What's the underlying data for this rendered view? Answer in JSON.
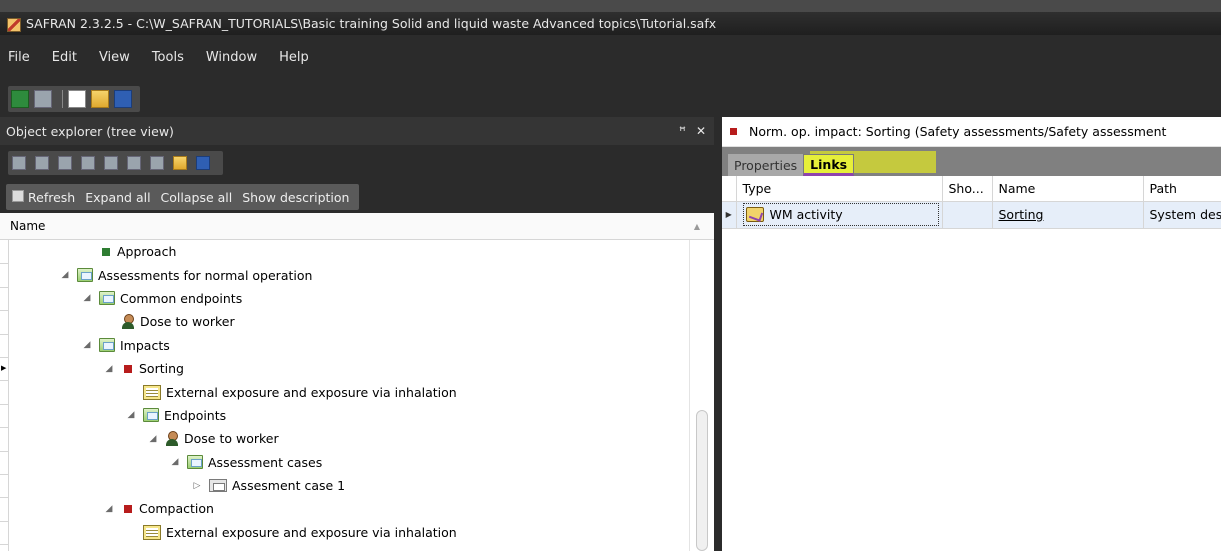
{
  "window": {
    "title": "SAFRAN 2.3.2.5 - C:\\W_SAFRAN_TUTORIALS\\Basic training Solid and liquid waste Advanced topics\\Tutorial.safx"
  },
  "menu": [
    "File",
    "Edit",
    "View",
    "Tools",
    "Window",
    "Help"
  ],
  "toolbar": {
    "icons": [
      "back-icon",
      "forward-icon",
      "new-file-icon",
      "open-folder-icon",
      "save-icon"
    ]
  },
  "object_explorer": {
    "title": "Object explorer (tree view)",
    "pin_glyph": "ꟸ",
    "close_glyph": "✕",
    "tools": [
      "copy-icon",
      "cut-icon",
      "paste-icon",
      "rename-icon",
      "delete-icon",
      "add-icon",
      "attach-icon",
      "properties-icon",
      "find-icon"
    ],
    "actions": {
      "refresh": "Refresh",
      "expand_all": "Expand all",
      "collapse_all": "Collapse all",
      "show_description": "Show description"
    },
    "column_header": "Name",
    "tree": [
      {
        "label": "Approach",
        "level": 4,
        "icon": "approach",
        "expander": "none"
      },
      {
        "label": "Assessments for normal operation",
        "level": 3,
        "icon": "folder",
        "expander": "expanded"
      },
      {
        "label": "Common endpoints",
        "level": 4,
        "icon": "folder",
        "expander": "expanded"
      },
      {
        "label": "Dose to worker",
        "level": 5,
        "icon": "person",
        "expander": "none"
      },
      {
        "label": "Impacts",
        "level": 4,
        "icon": "folder",
        "expander": "expanded"
      },
      {
        "label": "Sorting",
        "level": 5,
        "icon": "impact",
        "expander": "expanded"
      },
      {
        "label": "External exposure and exposure via inhalation",
        "level": 6,
        "icon": "sheet",
        "expander": "none"
      },
      {
        "label": "Endpoints",
        "level": 6,
        "icon": "folder",
        "expander": "expanded"
      },
      {
        "label": "Dose to worker",
        "level": 7,
        "icon": "person",
        "expander": "expanded"
      },
      {
        "label": "Assessment cases",
        "level": 8,
        "icon": "folder",
        "expander": "expanded"
      },
      {
        "label": "Assesment case 1",
        "level": 9,
        "icon": "case",
        "expander": "collapsed"
      },
      {
        "label": "Compaction",
        "level": 5,
        "icon": "impact",
        "expander": "expanded"
      },
      {
        "label": "External exposure and exposure via inhalation",
        "level": 6,
        "icon": "sheet",
        "expander": "none"
      }
    ]
  },
  "detail_panel": {
    "header": "Norm. op. impact: Sorting  (Safety assessments/Safety assessment",
    "tabs": {
      "properties": "Properties",
      "links": "Links"
    },
    "links_table": {
      "columns": [
        "Type",
        "Sho...",
        "Name",
        "Path"
      ],
      "rows": [
        {
          "type": "WM activity",
          "sho": "",
          "name": "Sorting",
          "path": "System desc"
        }
      ]
    }
  },
  "colors": {
    "dark_bg": "#2b2b2b",
    "impact_red": "#b71c1c",
    "approach_green": "#2e7d32",
    "highlight_yellow": "#e6ef3a",
    "tab_underline": "#8e44ad"
  }
}
